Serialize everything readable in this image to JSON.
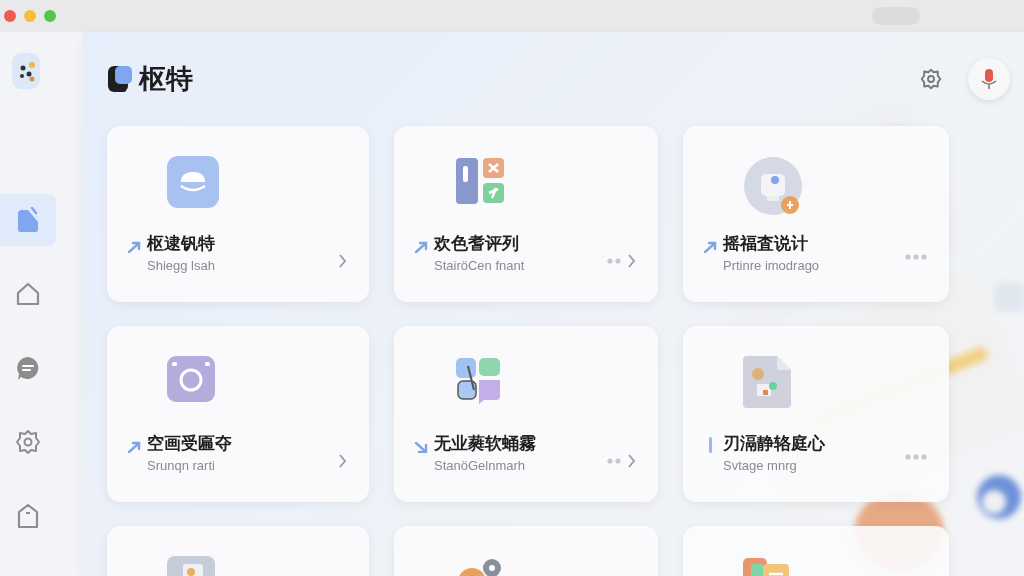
{
  "app": {
    "title": "枢特"
  },
  "sidebar": {
    "items": [
      {
        "selected": true
      },
      {
        "selected": false
      },
      {
        "selected": false
      },
      {
        "selected": false
      },
      {
        "selected": false
      }
    ]
  },
  "cards": [
    {
      "title": "枢逮钒特",
      "subtitle": "Shiegg lsah",
      "marker": {
        "kind": "arrow"
      },
      "more_button": false,
      "chevron": true
    },
    {
      "title": "欢色耆评列",
      "subtitle": "StairöCen fnant",
      "marker": {
        "kind": "arrow"
      },
      "more_button": true,
      "chevron": true
    },
    {
      "title": "摇福査说计",
      "subtitle": "Prtinre imodrago",
      "marker": {
        "kind": "arrow"
      },
      "more_button": true,
      "chevron": false
    },
    {
      "title": "空画受匾夺",
      "subtitle": "Srunqn rarti",
      "marker": {
        "kind": "arrow"
      },
      "more_button": false,
      "chevron": true
    },
    {
      "title": "无业蕤软蛹霧",
      "subtitle": "StanöGelnmarh",
      "marker": {
        "kind": "down_arrow"
      },
      "more_button": true,
      "chevron": true
    },
    {
      "title": "刃滆静辂庭心",
      "subtitle": "Svtage mnrg",
      "marker": {
        "kind": "bar"
      },
      "more_button": true,
      "chevron": false
    },
    {
      "cut_off": true
    },
    {
      "cut_off": true
    },
    {
      "cut_off": true
    }
  ]
}
